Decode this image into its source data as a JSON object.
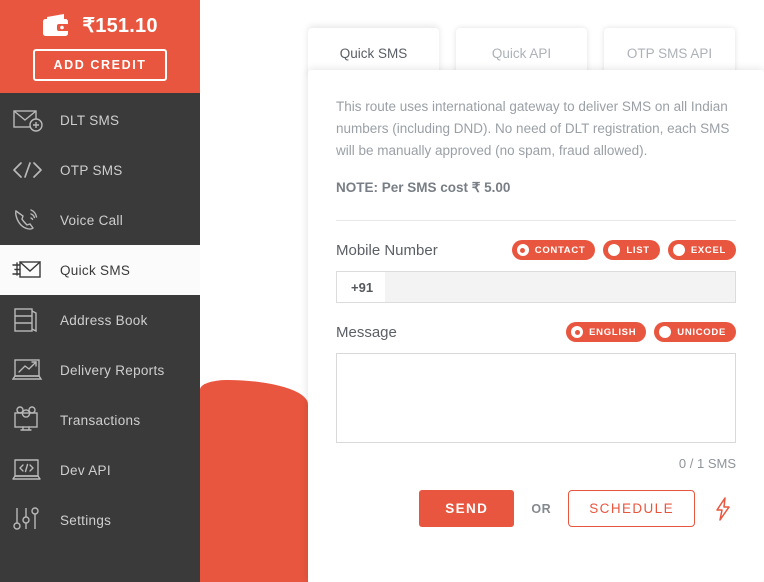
{
  "colors": {
    "accent": "#e9563f",
    "sidebar_bg": "#3a3a3a",
    "card_bg": "#ffffff",
    "muted_text": "#9aa0a6"
  },
  "sidebar": {
    "wallet": {
      "icon": "wallet-icon",
      "amount": "₹151.10",
      "add_credit_label": "ADD CREDIT"
    },
    "items": [
      {
        "label": "DLT SMS",
        "icon": "envelope-plus-icon",
        "active": false
      },
      {
        "label": "OTP SMS",
        "icon": "code-brackets-icon",
        "active": false
      },
      {
        "label": "Voice Call",
        "icon": "phone-ring-icon",
        "active": false
      },
      {
        "label": "Quick SMS",
        "icon": "envelope-fast-icon",
        "active": true
      },
      {
        "label": "Address Book",
        "icon": "book-icon",
        "active": false
      },
      {
        "label": "Delivery Reports",
        "icon": "laptop-chart-icon",
        "active": false
      },
      {
        "label": "Transactions",
        "icon": "monitor-coins-icon",
        "active": false
      },
      {
        "label": "Dev API",
        "icon": "monitor-code-icon",
        "active": false
      },
      {
        "label": "Settings",
        "icon": "sliders-icon",
        "active": false
      }
    ]
  },
  "main": {
    "tabs": [
      {
        "label": "Quick SMS",
        "active": true
      },
      {
        "label": "Quick API",
        "active": false
      },
      {
        "label": "OTP SMS API",
        "active": false
      }
    ],
    "description": "This route uses international gateway to deliver SMS on all Indian numbers (including DND). No need of DLT registration, each SMS will be manually approved (no spam, fraud allowed).",
    "note": "NOTE: Per SMS cost ₹ 5.00",
    "mobile": {
      "label": "Mobile Number",
      "options": [
        {
          "label": "CONTACT",
          "selected": true
        },
        {
          "label": "LIST",
          "selected": false
        },
        {
          "label": "EXCEL",
          "selected": false
        }
      ],
      "prefix": "+91",
      "value": "",
      "placeholder": ""
    },
    "message": {
      "label": "Message",
      "options": [
        {
          "label": "ENGLISH",
          "selected": true
        },
        {
          "label": "UNICODE",
          "selected": false
        }
      ],
      "value": "",
      "placeholder": "",
      "counter": "0 / 1 SMS"
    },
    "actions": {
      "send_label": "SEND",
      "or_label": "OR",
      "schedule_label": "SCHEDULE",
      "bolt_icon": "lightning-bolt-icon"
    }
  }
}
